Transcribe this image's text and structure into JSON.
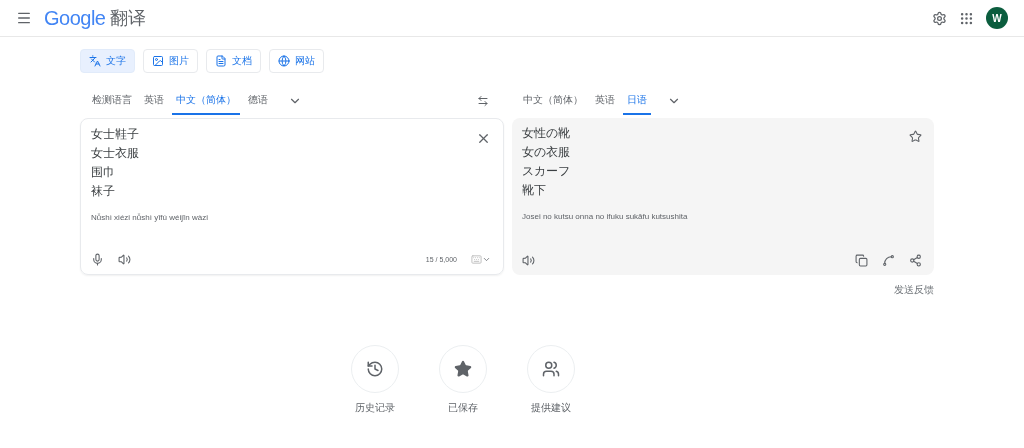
{
  "header": {
    "logo": "Google",
    "product": "翻译",
    "avatar": "W"
  },
  "modes": [
    {
      "label": "文字",
      "kind": "text",
      "selected": true
    },
    {
      "label": "图片",
      "kind": "image",
      "selected": false
    },
    {
      "label": "文档",
      "kind": "document",
      "selected": false
    },
    {
      "label": "网站",
      "kind": "website",
      "selected": false
    }
  ],
  "source_languages": [
    {
      "label": "检测语言",
      "selected": false
    },
    {
      "label": "英语",
      "selected": false
    },
    {
      "label": "中文（简体）",
      "selected": true
    },
    {
      "label": "德语",
      "selected": false
    }
  ],
  "target_languages": [
    {
      "label": "中文（简体）",
      "selected": false
    },
    {
      "label": "英语",
      "selected": false
    },
    {
      "label": "日语",
      "selected": true
    }
  ],
  "source": {
    "lines": [
      "女士鞋子",
      "女士衣服",
      "围巾",
      "袜子"
    ],
    "romanization": "Nǚshì xiézi nǚshì yīfú wéijīn wàzi",
    "count": "15 / 5,000"
  },
  "target": {
    "lines": [
      "女性の靴",
      "女の衣服",
      "スカーフ",
      "靴下"
    ],
    "romanization": "Josei no kutsu onna no ifuku sukāfu kutsushita"
  },
  "feedback": "发送反馈",
  "shortcuts": [
    {
      "label": "历史记录",
      "kind": "history"
    },
    {
      "label": "已保存",
      "kind": "saved"
    },
    {
      "label": "提供建议",
      "kind": "contribute"
    }
  ]
}
